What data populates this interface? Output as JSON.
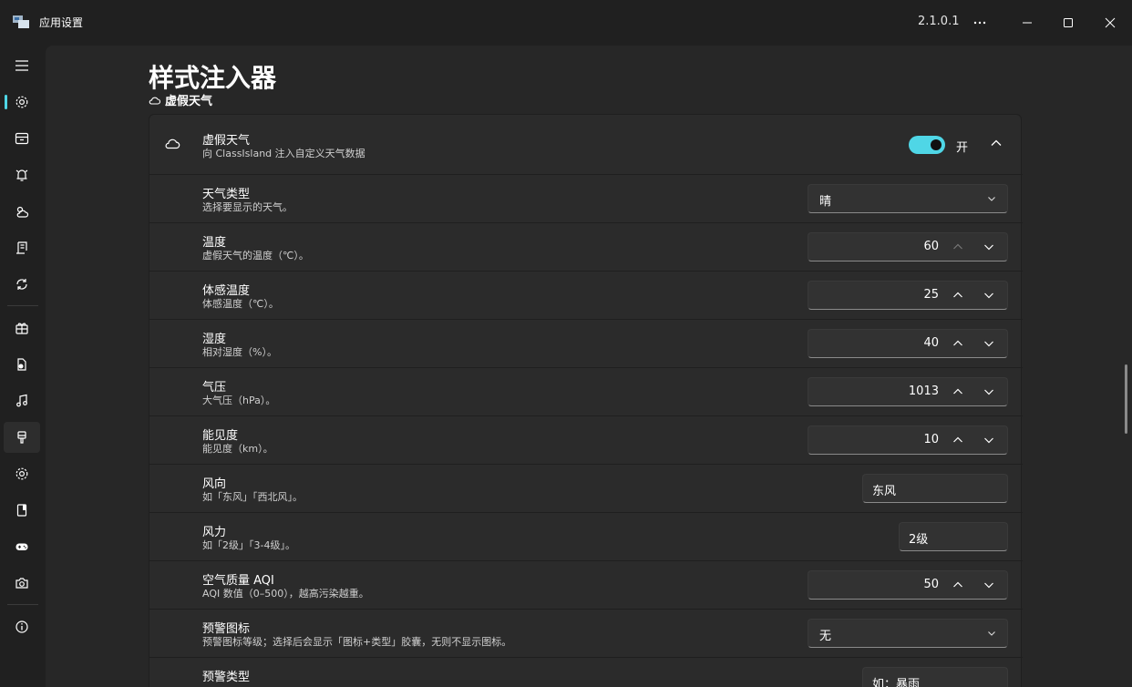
{
  "window": {
    "title": "应用设置",
    "version": "2.1.0.1"
  },
  "page": {
    "title": "样式注入器",
    "breadcrumb": "虚假天气"
  },
  "section": {
    "title": "虚假天气",
    "description": "向 ClassIsland 注入自定义天气数据",
    "toggle_on": true,
    "toggle_label": "开"
  },
  "rows": {
    "weather_type": {
      "title": "天气类型",
      "desc": "选择要显示的天气。",
      "value": "晴"
    },
    "temperature": {
      "title": "温度",
      "desc": "虚假天气的温度（℃）。",
      "value": "60"
    },
    "feels_like": {
      "title": "体感温度",
      "desc": "体感温度（℃）。",
      "value": "25"
    },
    "humidity": {
      "title": "湿度",
      "desc": "相对湿度（%）。",
      "value": "40"
    },
    "pressure": {
      "title": "气压",
      "desc": "大气压（hPa）。",
      "value": "1013"
    },
    "visibility": {
      "title": "能见度",
      "desc": "能见度（km）。",
      "value": "10"
    },
    "wind_direction": {
      "title": "风向",
      "desc": "如「东风」「西北风」。",
      "value": "东风"
    },
    "wind_force": {
      "title": "风力",
      "desc": "如「2级」「3-4级」。",
      "value": "2级"
    },
    "aqi": {
      "title": "空气质量 AQI",
      "desc": "AQI 数值（0–500），越高污染越重。",
      "value": "50"
    },
    "alert_icon": {
      "title": "预警图标",
      "desc": "预警图标等级；选择后会显示「图标+类型」胶囊，无则不显示图标。",
      "value": "无"
    },
    "alert_type": {
      "title": "预警类型",
      "placeholder": "如：暴雨"
    }
  },
  "colors": {
    "accent": "#4fd6e6",
    "background": "#202020",
    "content_bg": "#272727",
    "card_bg": "#2b2b2b"
  },
  "nav_icons": [
    "menu-icon",
    "gear-icon",
    "layout-icon",
    "alarm-icon",
    "weather-icon",
    "document-icon",
    "sync-icon",
    "components-icon",
    "file-icon",
    "music-icon",
    "brush-icon",
    "settings-icon",
    "book-icon",
    "gamepad-icon",
    "camera-icon",
    "info-icon"
  ]
}
